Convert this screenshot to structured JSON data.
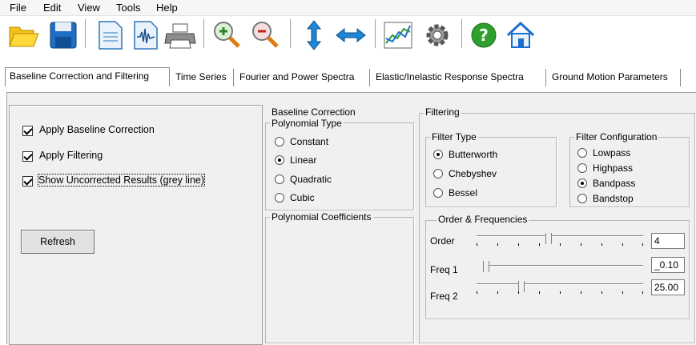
{
  "menu": {
    "file": "File",
    "edit": "Edit",
    "view": "View",
    "tools": "Tools",
    "help": "Help"
  },
  "toolbar": {
    "icons": [
      "open-folder-icon",
      "save-icon",
      "new-document-icon",
      "waveform-document-icon",
      "print-icon",
      "zoom-in-icon",
      "zoom-out-icon",
      "vertical-arrows-icon",
      "horizontal-arrows-icon",
      "chart-icon",
      "settings-gear-icon",
      "help-icon",
      "home-icon"
    ]
  },
  "tabs": [
    {
      "label": "Baseline Correction and Filtering",
      "active": true
    },
    {
      "label": "Time Series",
      "active": false
    },
    {
      "label": "Fourier and Power Spectra",
      "active": false
    },
    {
      "label": "Elastic/Inelastic Response Spectra",
      "active": false
    },
    {
      "label": "Ground Motion Parameters",
      "active": false
    }
  ],
  "left": {
    "apply_baseline": "Apply Baseline Correction",
    "apply_filtering": "Apply Filtering",
    "show_uncorrected": "Show Uncorrected Results (grey line)",
    "refresh": "Refresh"
  },
  "baseline": {
    "title": "Baseline Correction",
    "poly_type_title": "Polynomial Type",
    "options": [
      "Constant",
      "Linear",
      "Quadratic",
      "Cubic"
    ],
    "selected": "Linear",
    "coeff_title": "Polynomial Coefficients"
  },
  "filtering": {
    "title": "Filtering",
    "filter_type_title": "Filter Type",
    "filter_types": [
      "Butterworth",
      "Chebyshev",
      "Bessel"
    ],
    "filter_type_selected": "Butterworth",
    "config_title": "Filter Configuration",
    "configs": [
      "Lowpass",
      "Highpass",
      "Bandpass",
      "Bandstop"
    ],
    "config_selected": "Bandpass",
    "order_freq_title": "Order & Frequencies",
    "order_label": "Order",
    "order_value": "4",
    "freq1_label": "Freq 1",
    "freq1_value": "_0.10",
    "freq2_label": "Freq 2",
    "freq2_value": "25.00"
  },
  "colors": {
    "panel_bg": "#f0f0f0",
    "border": "#a0a0a0"
  }
}
